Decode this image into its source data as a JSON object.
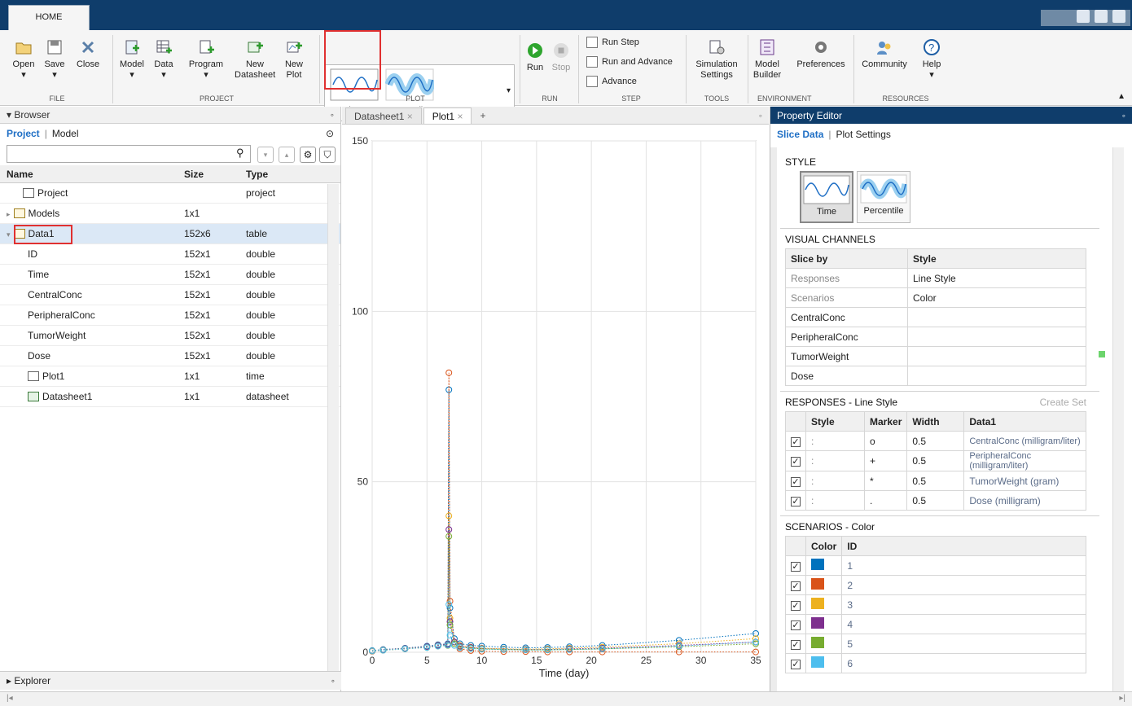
{
  "ribbon": {
    "home_tab": "HOME",
    "file": {
      "open": "Open",
      "save": "Save",
      "close": "Close",
      "group": "FILE"
    },
    "project": {
      "model": "Model",
      "data": "Data",
      "program": "Program",
      "new_datasheet": "New Datasheet",
      "new_plot": "New Plot",
      "group": "PROJECT"
    },
    "plot": {
      "time": "time",
      "percentile": "percentile",
      "group": "PLOT"
    },
    "run": {
      "run": "Run",
      "stop": "Stop",
      "group": "RUN"
    },
    "step": {
      "run_step": "Run Step",
      "run_and_advance": "Run and Advance",
      "advance": "Advance",
      "group": "STEP"
    },
    "tools": {
      "simulation_settings": "Simulation Settings",
      "group": "TOOLS"
    },
    "environment": {
      "model_builder": "Model Builder",
      "preferences": "Preferences",
      "group": "ENVIRONMENT"
    },
    "resources": {
      "community": "Community",
      "help": "Help",
      "group": "RESOURCES"
    }
  },
  "browser": {
    "title": "Browser",
    "link_project": "Project",
    "link_model": "Model",
    "columns": [
      "Name",
      "Size",
      "Type"
    ],
    "rows": [
      {
        "name": "Project",
        "size": "",
        "type": "project"
      },
      {
        "name": "Models",
        "size": "1x1",
        "type": ""
      },
      {
        "name": "Data1",
        "size": "152x6",
        "type": "table"
      },
      {
        "name": "ID",
        "size": "152x1",
        "type": "double"
      },
      {
        "name": "Time",
        "size": "152x1",
        "type": "double"
      },
      {
        "name": "CentralConc",
        "size": "152x1",
        "type": "double"
      },
      {
        "name": "PeripheralConc",
        "size": "152x1",
        "type": "double"
      },
      {
        "name": "TumorWeight",
        "size": "152x1",
        "type": "double"
      },
      {
        "name": "Dose",
        "size": "152x1",
        "type": "double"
      },
      {
        "name": "Plot1",
        "size": "1x1",
        "type": "time"
      },
      {
        "name": "Datasheet1",
        "size": "1x1",
        "type": "datasheet"
      }
    ],
    "explorer": "Explorer"
  },
  "doc_tabs": {
    "datasheet": "Datasheet1",
    "plot": "Plot1",
    "add": "+"
  },
  "chart_data": {
    "type": "line",
    "xlabel": "Time (day)",
    "ylabel": "",
    "xlim": [
      0,
      35
    ],
    "ylim": [
      0,
      150
    ],
    "xticks": [
      0,
      5,
      10,
      15,
      20,
      25,
      30,
      35
    ],
    "yticks": [
      0,
      50,
      100,
      150
    ],
    "grid": true,
    "series": [
      {
        "color": "#0072bd",
        "x": [
          0,
          1,
          3,
          5,
          6,
          6.9,
          7,
          7.1,
          7.5,
          8,
          9,
          10,
          12,
          14,
          16,
          18,
          21,
          28,
          35
        ],
        "y": [
          0.5,
          0.8,
          1.2,
          1.8,
          2.2,
          2.5,
          77,
          13,
          4,
          2.5,
          2,
          1.8,
          1.5,
          1.3,
          1.4,
          1.6,
          2,
          3.5,
          5.5
        ]
      },
      {
        "color": "#d95319",
        "x": [
          0,
          1,
          3,
          5,
          6,
          6.9,
          7,
          7.1,
          7.5,
          8,
          9,
          10,
          12,
          14,
          16,
          18,
          21,
          28,
          35
        ],
        "y": [
          0.3,
          0.6,
          1,
          1.5,
          2,
          2.2,
          82,
          15,
          3,
          1,
          0.5,
          0.3,
          0.2,
          0.2,
          0.1,
          0.1,
          0.1,
          0.1,
          0.1
        ]
      },
      {
        "color": "#edb120",
        "x": [
          0,
          1,
          3,
          5,
          6,
          6.9,
          7,
          7.1,
          7.5,
          8,
          9,
          10,
          12,
          14,
          16,
          18,
          21,
          28,
          35
        ],
        "y": [
          0.4,
          0.7,
          1.1,
          1.6,
          2,
          2.3,
          40,
          10,
          3,
          2,
          1.5,
          1.2,
          1,
          0.9,
          1,
          1.2,
          1.5,
          2.5,
          4
        ]
      },
      {
        "color": "#7e2f8e",
        "x": [
          0,
          1,
          3,
          5,
          6,
          6.9,
          7,
          7.1,
          7.5,
          8,
          9,
          10,
          12,
          14,
          16,
          18,
          21,
          28,
          35
        ],
        "y": [
          0.4,
          0.7,
          1.1,
          1.6,
          2,
          2.3,
          36,
          9,
          3,
          1.8,
          1.4,
          1.1,
          0.9,
          0.8,
          0.8,
          1,
          1.2,
          2,
          3
        ]
      },
      {
        "color": "#77ac30",
        "x": [
          0,
          1,
          3,
          5,
          6,
          6.9,
          7,
          7.1,
          7.5,
          8,
          9,
          10,
          12,
          14,
          16,
          18,
          21,
          28,
          35
        ],
        "y": [
          0.4,
          0.6,
          1,
          1.4,
          1.8,
          2,
          34,
          8,
          2.5,
          1.5,
          1.2,
          1,
          0.8,
          0.7,
          0.7,
          0.8,
          1,
          1.6,
          2.5
        ]
      },
      {
        "color": "#4dbeee",
        "x": [
          0,
          1,
          3,
          5,
          6,
          6.9,
          7,
          7.1,
          7.5,
          8,
          9,
          10,
          12,
          14,
          16,
          18,
          21,
          28,
          35
        ],
        "y": [
          0.4,
          0.6,
          1,
          1.4,
          1.8,
          2.1,
          14,
          5,
          2,
          1.4,
          1.1,
          0.9,
          0.8,
          0.7,
          0.7,
          0.8,
          1,
          1.8,
          3
        ]
      }
    ]
  },
  "property_editor": {
    "title": "Property Editor",
    "tab_slice": "Slice Data",
    "tab_plot": "Plot Settings",
    "style": {
      "title": "STYLE",
      "time": "Time",
      "percentile": "Percentile"
    },
    "visual_channels": {
      "title": "VISUAL CHANNELS",
      "col_slice": "Slice by",
      "col_style": "Style",
      "rows": [
        {
          "slice": "Responses",
          "style": "Line Style"
        },
        {
          "slice": "Scenarios",
          "style": "Color"
        },
        {
          "slice": "CentralConc",
          "style": ""
        },
        {
          "slice": "PeripheralConc",
          "style": ""
        },
        {
          "slice": "TumorWeight",
          "style": ""
        },
        {
          "slice": "Dose",
          "style": ""
        }
      ]
    },
    "responses": {
      "title": "RESPONSES - Line Style",
      "create_set": "Create Set",
      "cols": [
        "Style",
        "Marker",
        "Width",
        "Data1"
      ],
      "rows": [
        {
          "style": ":",
          "marker": "o",
          "width": "0.5",
          "data": "CentralConc (milligram/liter)"
        },
        {
          "style": ":",
          "marker": "+",
          "width": "0.5",
          "data": "PeripheralConc (milligram/liter)"
        },
        {
          "style": ":",
          "marker": "*",
          "width": "0.5",
          "data": "TumorWeight (gram)"
        },
        {
          "style": ":",
          "marker": ".",
          "width": "0.5",
          "data": "Dose (milligram)"
        }
      ]
    },
    "scenarios": {
      "title": "SCENARIOS - Color",
      "cols": [
        "Color",
        "ID"
      ],
      "rows": [
        {
          "color": "#0072bd",
          "id": "1"
        },
        {
          "color": "#d95319",
          "id": "2"
        },
        {
          "color": "#edb120",
          "id": "3"
        },
        {
          "color": "#7e2f8e",
          "id": "4"
        },
        {
          "color": "#77ac30",
          "id": "5"
        },
        {
          "color": "#4dbeee",
          "id": "6"
        }
      ]
    }
  }
}
